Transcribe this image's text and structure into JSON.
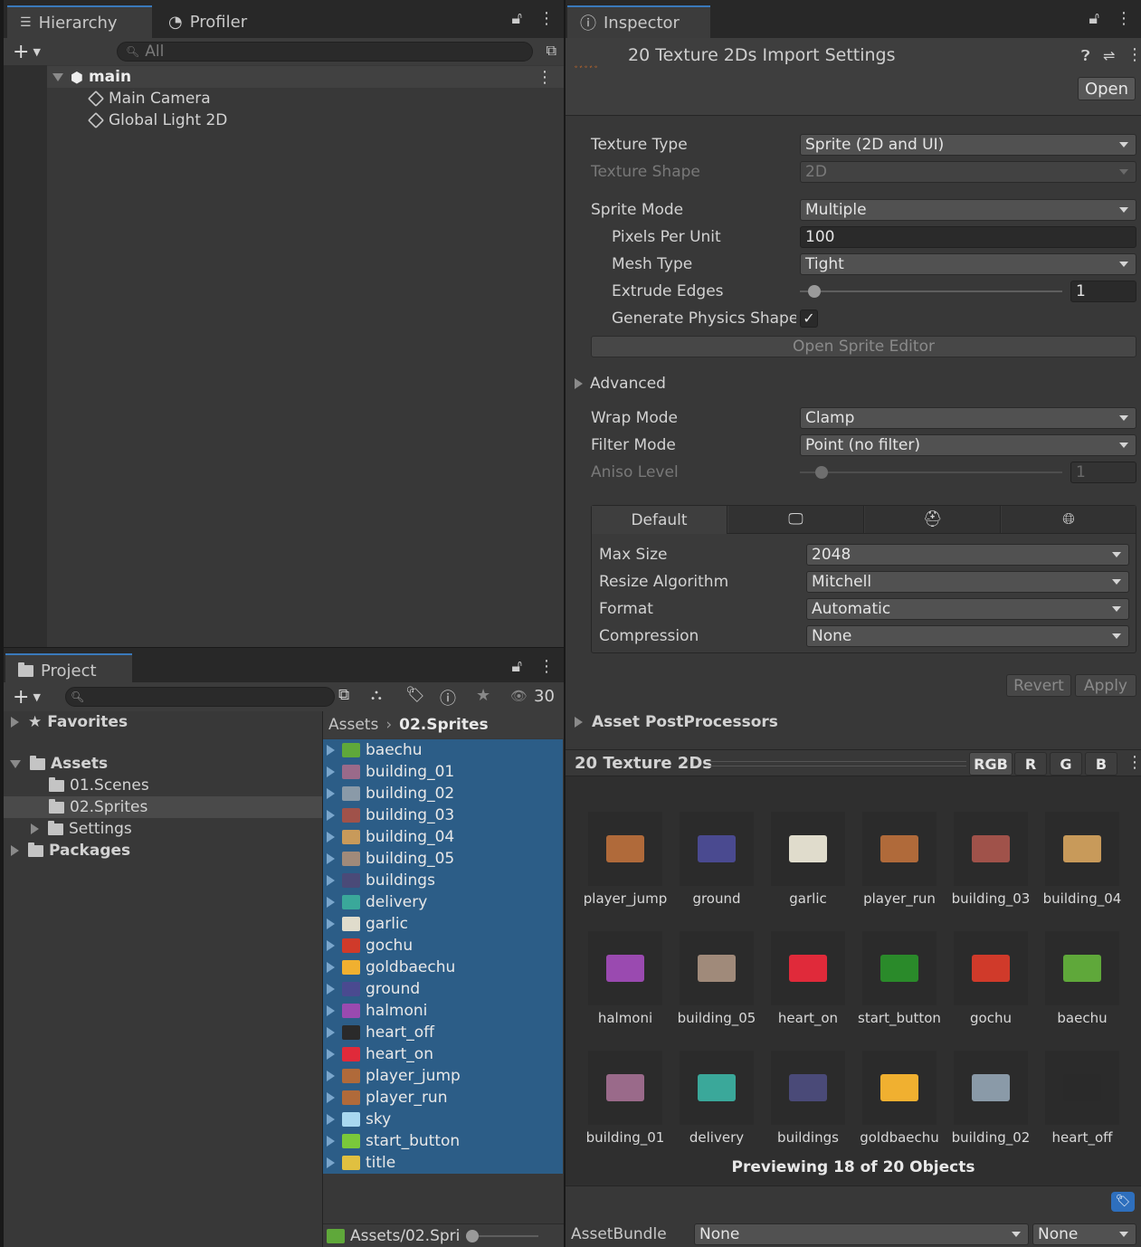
{
  "hierarchy": {
    "tabs": [
      "Hierarchy",
      "Profiler"
    ],
    "search_placeholder": "All",
    "scene": "main",
    "objects": [
      "Main Camera",
      "Global Light 2D"
    ]
  },
  "project": {
    "tab": "Project",
    "count": "30",
    "favorites": "Favorites",
    "tree": [
      {
        "label": "Assets",
        "bold": true
      },
      {
        "label": "01.Scenes"
      },
      {
        "label": "02.Sprites"
      },
      {
        "label": "Settings"
      },
      {
        "label": "Packages",
        "bold": true
      }
    ],
    "breadcrumb": {
      "root": "Assets",
      "current": "02.Sprites"
    },
    "files": [
      {
        "name": "baechu",
        "color": "#5fa83a"
      },
      {
        "name": "building_01",
        "color": "#9a6a8a"
      },
      {
        "name": "building_02",
        "color": "#8a9aa8"
      },
      {
        "name": "building_03",
        "color": "#a0524a"
      },
      {
        "name": "building_04",
        "color": "#c89a5a"
      },
      {
        "name": "building_05",
        "color": "#a08a7a"
      },
      {
        "name": "buildings",
        "color": "#4a4a78"
      },
      {
        "name": "delivery",
        "color": "#3aa89a"
      },
      {
        "name": "garlic",
        "color": "#e0dccc"
      },
      {
        "name": "gochu",
        "color": "#d03a2a"
      },
      {
        "name": "goldbaechu",
        "color": "#f0b030"
      },
      {
        "name": "ground",
        "color": "#4a4a90"
      },
      {
        "name": "halmoni",
        "color": "#9a4ab0"
      },
      {
        "name": "heart_off",
        "color": "#2a2a2a"
      },
      {
        "name": "heart_on",
        "color": "#e02a3a"
      },
      {
        "name": "player_jump",
        "color": "#b06a3a"
      },
      {
        "name": "player_run",
        "color": "#b06a3a"
      },
      {
        "name": "sky",
        "color": "#a8d8f0"
      },
      {
        "name": "start_button",
        "color": "#7ac83a"
      },
      {
        "name": "title",
        "color": "#e0c040"
      }
    ],
    "footer_path": "Assets/02.Spri"
  },
  "inspector": {
    "tab": "Inspector",
    "title": "20 Texture 2Ds Import Settings",
    "open_label": "Open",
    "fields": {
      "texture_type": {
        "label": "Texture Type",
        "value": "Sprite (2D and UI)"
      },
      "texture_shape": {
        "label": "Texture Shape",
        "value": "2D"
      },
      "sprite_mode": {
        "label": "Sprite Mode",
        "value": "Multiple"
      },
      "pixels_per_unit": {
        "label": "Pixels Per Unit",
        "value": "100"
      },
      "mesh_type": {
        "label": "Mesh Type",
        "value": "Tight"
      },
      "extrude_edges": {
        "label": "Extrude Edges",
        "value": "1"
      },
      "generate_physics": {
        "label": "Generate Physics Shape",
        "checked": true
      },
      "open_sprite_editor": "Open Sprite Editor",
      "advanced": "Advanced",
      "wrap_mode": {
        "label": "Wrap Mode",
        "value": "Clamp"
      },
      "filter_mode": {
        "label": "Filter Mode",
        "value": "Point (no filter)"
      },
      "aniso_level": {
        "label": "Aniso Level",
        "value": "1"
      }
    },
    "platform": {
      "default_tab": "Default",
      "max_size": {
        "label": "Max Size",
        "value": "2048"
      },
      "resize": {
        "label": "Resize Algorithm",
        "value": "Mitchell"
      },
      "format": {
        "label": "Format",
        "value": "Automatic"
      },
      "compression": {
        "label": "Compression",
        "value": "None"
      }
    },
    "revert": "Revert",
    "apply": "Apply",
    "postprocessors": "Asset PostProcessors"
  },
  "preview": {
    "title": "20 Texture 2Ds",
    "channels": [
      "RGB",
      "R",
      "G",
      "B"
    ],
    "items": [
      {
        "name": "player_jump",
        "color": "#b06a3a"
      },
      {
        "name": "ground",
        "color": "#4a4a90"
      },
      {
        "name": "garlic",
        "color": "#e0dccc"
      },
      {
        "name": "player_run",
        "color": "#b06a3a"
      },
      {
        "name": "building_03",
        "color": "#a0524a"
      },
      {
        "name": "building_04",
        "color": "#c89a5a"
      },
      {
        "name": "halmoni",
        "color": "#9a4ab0"
      },
      {
        "name": "building_05",
        "color": "#a08a7a"
      },
      {
        "name": "heart_on",
        "color": "#e02a3a"
      },
      {
        "name": "start_button",
        "color": "#2a8a2a"
      },
      {
        "name": "gochu",
        "color": "#d03a2a"
      },
      {
        "name": "baechu",
        "color": "#5fa83a"
      },
      {
        "name": "building_01",
        "color": "#9a6a8a"
      },
      {
        "name": "delivery",
        "color": "#3aa89a"
      },
      {
        "name": "buildings",
        "color": "#4a4a78"
      },
      {
        "name": "goldbaechu",
        "color": "#f0b030"
      },
      {
        "name": "building_02",
        "color": "#8a9aa8"
      },
      {
        "name": "heart_off",
        "color": "#2a2a2a"
      }
    ],
    "status": "Previewing 18 of 20 Objects"
  },
  "assetbundle": {
    "label": "AssetBundle",
    "value": "None",
    "variant": "None"
  },
  "colors": {
    "selection": "#2c5d87",
    "accent": "#3a79bb"
  }
}
